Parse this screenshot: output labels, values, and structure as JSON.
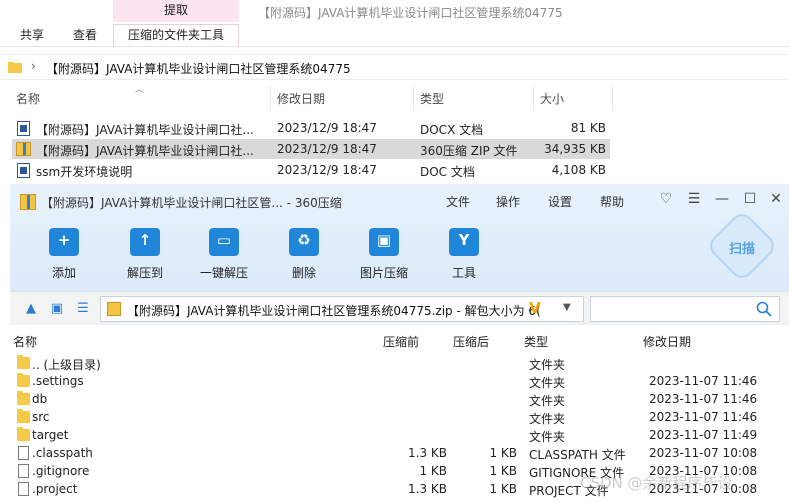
{
  "explorer": {
    "window_title": "【附源码】JAVA计算机毕业设计闸口社区管理系统04775",
    "contextual_tab_header": "提取",
    "tabs": [
      "共享",
      "查看",
      "压缩的文件夹工具"
    ],
    "address": {
      "separator": "›",
      "path": "【附源码】JAVA计算机毕业设计闸口社区管理系统04775"
    },
    "columns": [
      "名称",
      "修改日期",
      "类型",
      "大小"
    ],
    "files": [
      {
        "name": "【附源码】JAVA计算机毕业设计闸口社...",
        "date": "2023/12/9 18:47",
        "type": "DOCX 文档",
        "size": "81 KB",
        "icon": "word-doc-icon"
      },
      {
        "name": "【附源码】JAVA计算机毕业设计闸口社...",
        "date": "2023/12/9 18:47",
        "type": "360压缩 ZIP 文件",
        "size": "34,935 KB",
        "icon": "zip-archive-icon",
        "selected": true
      },
      {
        "name": "ssm开发环境说明",
        "date": "2023/12/9 18:47",
        "type": "DOC 文档",
        "size": "4,108 KB",
        "icon": "word-doc-icon"
      }
    ]
  },
  "zip": {
    "title": "【附源码】JAVA计算机毕业设计闸口社区管... - 360压缩",
    "menus": [
      "文件",
      "操作",
      "设置",
      "帮助"
    ],
    "window_controls": [
      "♡",
      "☰",
      "—",
      "☐",
      "✕"
    ],
    "toolbar": [
      {
        "label": "添加",
        "icon": "add-icon",
        "glyph": "+"
      },
      {
        "label": "解压到",
        "icon": "extract-to-icon",
        "glyph": "↑"
      },
      {
        "label": "一键解压",
        "icon": "one-click-extract-icon",
        "glyph": "▭"
      },
      {
        "label": "删除",
        "icon": "delete-icon",
        "glyph": "♻"
      },
      {
        "label": "图片压缩",
        "icon": "image-compress-icon",
        "glyph": "▣"
      },
      {
        "label": "工具",
        "icon": "tools-icon",
        "glyph": "Y"
      }
    ],
    "scan_label": "扫描",
    "path_text": "【附源码】JAVA计算机毕业设计闸口社区管理系统04775.zip - 解包大小为 6(",
    "path_badge": "V",
    "columns": [
      "名称",
      "压缩前",
      "压缩后",
      "类型",
      "修改日期"
    ],
    "entries": [
      {
        "name": ".. (上级目录)",
        "before": "",
        "after": "",
        "type": "文件夹",
        "date": "",
        "kind": "folder"
      },
      {
        "name": ".settings",
        "before": "",
        "after": "",
        "type": "文件夹",
        "date": "2023-11-07 11:46",
        "kind": "folder"
      },
      {
        "name": "db",
        "before": "",
        "after": "",
        "type": "文件夹",
        "date": "2023-11-07 11:46",
        "kind": "folder"
      },
      {
        "name": "src",
        "before": "",
        "after": "",
        "type": "文件夹",
        "date": "2023-11-07 11:46",
        "kind": "folder"
      },
      {
        "name": "target",
        "before": "",
        "after": "",
        "type": "文件夹",
        "date": "2023-11-07 11:49",
        "kind": "folder"
      },
      {
        "name": ".classpath",
        "before": "1.3 KB",
        "after": "1 KB",
        "type": "CLASSPATH 文件",
        "date": "2023-11-07 10:08",
        "kind": "file"
      },
      {
        "name": ".gitignore",
        "before": "1 KB",
        "after": "1 KB",
        "type": "GITIGNORE 文件",
        "date": "2023-11-07 10:08",
        "kind": "file"
      },
      {
        "name": ".project",
        "before": "1.3 KB",
        "after": "1 KB",
        "type": "PROJECT 文件",
        "date": "2023-11-07 10:08",
        "kind": "file"
      }
    ]
  },
  "watermark": "CSDN @余新程序毕设"
}
